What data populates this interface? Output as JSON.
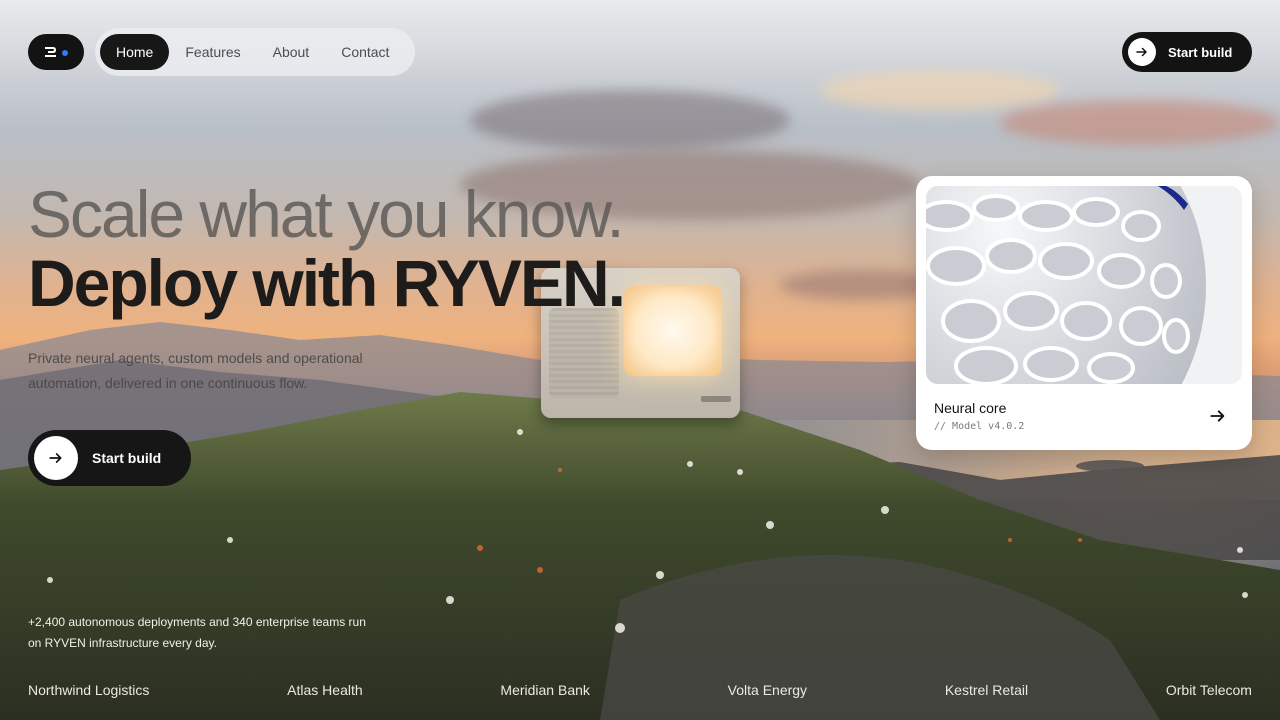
{
  "brand": {
    "logo_icon": "ryven-mark-icon",
    "accent": "#2f7bff"
  },
  "nav": {
    "items": [
      {
        "label": "Home",
        "active": true
      },
      {
        "label": "Features",
        "active": false
      },
      {
        "label": "About",
        "active": false
      },
      {
        "label": "Contact",
        "active": false
      }
    ]
  },
  "header_cta": {
    "label": "Start build",
    "icon": "arrow-right-icon"
  },
  "hero": {
    "line1": "Scale what you know.",
    "line2": "Deploy with RYVEN.",
    "subtitle": "Private neural agents, custom models and operational automation, delivered in one continuous flow.",
    "cta_label": "Start build",
    "cta_icon": "arrow-right-icon"
  },
  "card": {
    "title": "Neural core",
    "subtitle": "// Model v4.0.2",
    "icon": "arrow-right-icon"
  },
  "stats": {
    "text": "+2,400 autonomous deployments and 340 enterprise teams run on RYVEN infrastructure every day."
  },
  "clients": [
    "Northwind Logistics",
    "Atlas Health",
    "Meridian Bank",
    "Volta Energy",
    "Kestrel Retail",
    "Orbit Telecom"
  ],
  "colors": {
    "dark": "#131313",
    "nav_bg": "#ebedf0",
    "card_bg": "#ffffff"
  }
}
